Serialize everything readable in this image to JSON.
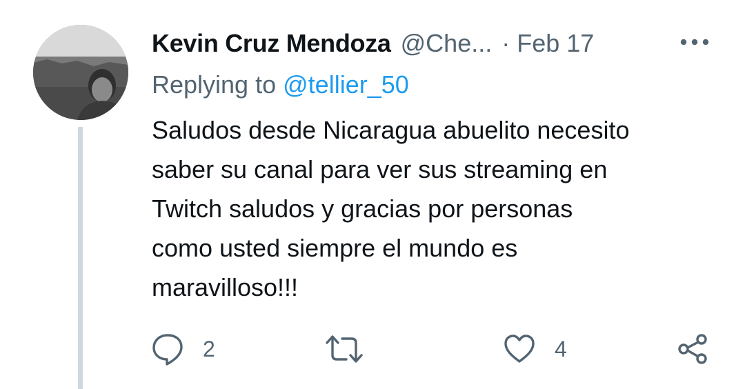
{
  "tweet": {
    "author_name": "Kevin Cruz Mendoza",
    "author_handle": "@Che...",
    "separator": "·",
    "date": "Feb 17",
    "replying_prefix": "Replying to",
    "replying_handle": "@tellier_50",
    "text_lines": [
      "Saludos desde Nicaragua abuelito necesito",
      "saber su canal para ver sus streaming en",
      "Twitch saludos y gracias por personas",
      "como usted siempre el mundo es",
      "maravilloso!!!"
    ]
  },
  "actions": {
    "reply_count": "2",
    "retweet_count": "",
    "like_count": "4"
  },
  "icons": {
    "more": "more-horizontal-icon",
    "reply": "reply-icon",
    "retweet": "retweet-icon",
    "like": "heart-icon",
    "share": "share-icon"
  },
  "colors": {
    "text": "#0f1419",
    "secondary": "#536471",
    "link": "#1d9bf0",
    "thread_line": "#cfd9de"
  }
}
